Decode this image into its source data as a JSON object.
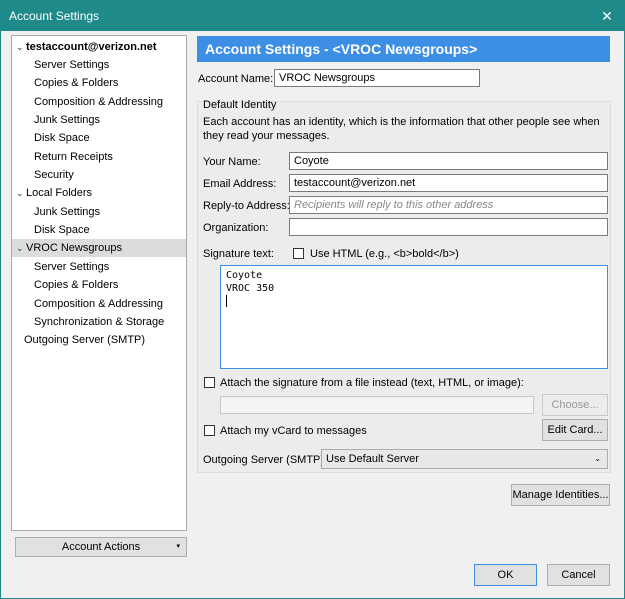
{
  "window": {
    "title": "Account Settings",
    "close_glyph": "✕"
  },
  "tree": {
    "items": [
      {
        "label": "testaccount@verizon.net",
        "type": "account",
        "expanded": true
      },
      {
        "label": "Server Settings",
        "type": "child"
      },
      {
        "label": "Copies & Folders",
        "type": "child"
      },
      {
        "label": "Composition & Addressing",
        "type": "child"
      },
      {
        "label": "Junk Settings",
        "type": "child"
      },
      {
        "label": "Disk Space",
        "type": "child"
      },
      {
        "label": "Return Receipts",
        "type": "child"
      },
      {
        "label": "Security",
        "type": "child"
      },
      {
        "label": "Local Folders",
        "type": "account",
        "expanded": true
      },
      {
        "label": "Junk Settings",
        "type": "child"
      },
      {
        "label": "Disk Space",
        "type": "child"
      },
      {
        "label": "VROC Newsgroups",
        "type": "account",
        "expanded": true,
        "selected": true
      },
      {
        "label": "Server Settings",
        "type": "child"
      },
      {
        "label": "Copies & Folders",
        "type": "child"
      },
      {
        "label": "Composition & Addressing",
        "type": "child"
      },
      {
        "label": "Synchronization & Storage",
        "type": "child"
      },
      {
        "label": "Outgoing Server (SMTP)",
        "type": "account"
      }
    ],
    "account_actions": "Account Actions",
    "chevron_glyph": "⌄",
    "dropdown_glyph": "▾"
  },
  "main": {
    "header": "Account Settings - <VROC Newsgroups>",
    "account_name_label": "Account Name:",
    "account_name_value": "VROC Newsgroups",
    "default_identity_label": "Default Identity",
    "identity_description": "Each account has an identity, which is the information that other people see when they read your messages.",
    "your_name_label": "Your Name:",
    "your_name_value": "Coyote",
    "email_label": "Email Address:",
    "email_value": "testaccount@verizon.net",
    "reply_to_label": "Reply-to Address:",
    "reply_to_placeholder": "Recipients will reply to this other address",
    "organization_label": "Organization:",
    "organization_value": "",
    "signature_label": "Signature text:",
    "use_html_label": "Use HTML (e.g., <b>bold</b>)",
    "signature_lines": [
      "Coyote",
      "VROC 350"
    ],
    "attach_file_label": "Attach the signature from a file instead (text, HTML, or image):",
    "choose_button": "Choose...",
    "attach_vcard_label": "Attach my vCard to messages",
    "edit_card_button": "Edit Card...",
    "outgoing_server_label": "Outgoing Server (SMTP):",
    "outgoing_server_value": "Use Default Server",
    "manage_identities_button": "Manage Identities..."
  },
  "footer": {
    "ok": "OK",
    "cancel": "Cancel"
  },
  "colors": {
    "titlebar": "#1e8a8a",
    "header": "#3d8ee5"
  }
}
